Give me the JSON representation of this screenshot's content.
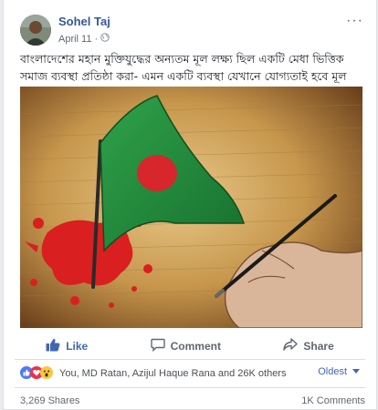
{
  "post": {
    "author": "Sohel Taj",
    "date": "April 11",
    "separator": "·",
    "privacy_icon": "globe-icon",
    "more_icon": "more-options-icon",
    "text": "বাংলাদেশের মহান মুক্তিযুদ্ধের অন্যতম মূল লক্ষ্য ছিল একটি মেধা ভিত্তিক সমাজ ব্যবস্থা প্রতিষ্ঠা করা- এমন একটি ব্যবস্থা যেখানে যোগ্যতাই হবে মূল মাপকাঠি।"
  },
  "image": {
    "subject": "bangladesh-flag-painted-by-hand-icon",
    "colors": {
      "flag_green": "#1f8a3a",
      "flag_red": "#d7262c",
      "background": "#c6964c",
      "splatter": "#d91f1f"
    }
  },
  "actions": {
    "like": "Like",
    "comment": "Comment",
    "share": "Share"
  },
  "reactions": {
    "summary": "You, MD Ratan, Azijul Haque Rana and 26K others",
    "sort_label": "Oldest"
  },
  "footer": {
    "shares": "3,269 Shares",
    "comments": "1K Comments"
  },
  "colors": {
    "link": "#365899",
    "accent": "#4267b2"
  }
}
